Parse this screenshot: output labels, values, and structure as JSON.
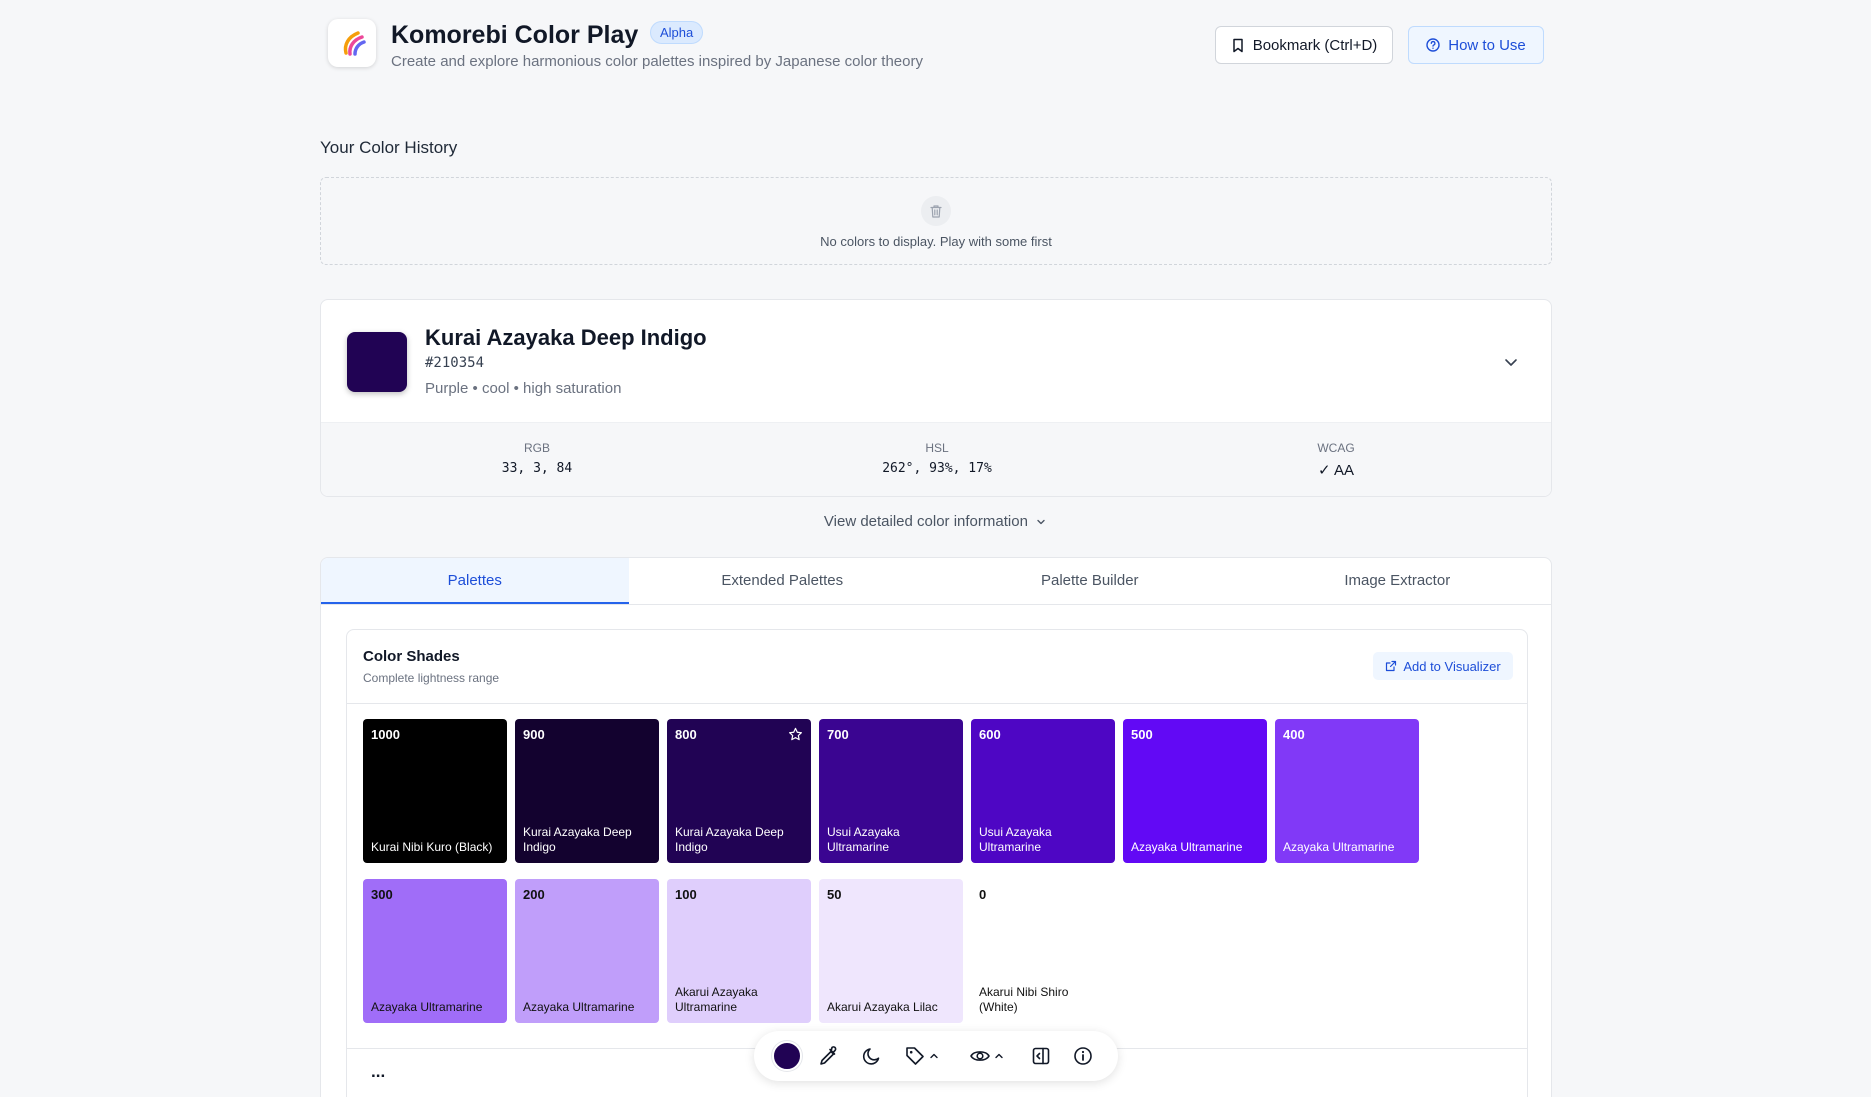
{
  "header": {
    "title": "Komorebi Color Play",
    "badge": "Alpha",
    "subtitle": "Create and explore harmonious color palettes inspired by Japanese color theory",
    "bookmark_label": "Bookmark (Ctrl+D)",
    "howto_label": "How to Use"
  },
  "history": {
    "title": "Your Color History",
    "empty_text": "No colors to display. Play with some first"
  },
  "color": {
    "name": "Kurai Azayaka Deep Indigo",
    "hex": "#210354",
    "description": "Purple • cool • high saturation",
    "swatch_color": "#210354",
    "rgb_label": "RGB",
    "rgb_value": "33, 3, 84",
    "hsl_label": "HSL",
    "hsl_value": "262°, 93%, 17%",
    "wcag_label": "WCAG",
    "wcag_value": "✓ AA"
  },
  "view_detail_label": "View detailed color information",
  "tabs": [
    {
      "label": "Palettes",
      "active": true
    },
    {
      "label": "Extended Palettes",
      "active": false
    },
    {
      "label": "Palette Builder",
      "active": false
    },
    {
      "label": "Image Extractor",
      "active": false
    }
  ],
  "shades": {
    "title": "Color Shades",
    "subtitle": "Complete lightness range",
    "visualizer_label": "Add to Visualizer",
    "more": "...",
    "items": [
      {
        "num": "1000",
        "name": "Kurai Nibi Kuro (Black)",
        "color": "#000000",
        "text_color": "#ffffff",
        "starred": false
      },
      {
        "num": "900",
        "name": "Kurai Azayaka Deep Indigo",
        "color": "#13022f",
        "text_color": "#ffffff",
        "starred": false
      },
      {
        "num": "800",
        "name": "Kurai Azayaka Deep Indigo",
        "color": "#210354",
        "text_color": "#ffffff",
        "starred": true
      },
      {
        "num": "700",
        "name": "Usui Azayaka Ultramarine",
        "color": "#3a0591",
        "text_color": "#ffffff",
        "starred": false
      },
      {
        "num": "600",
        "name": "Usui Azayaka Ultramarine",
        "color": "#4e06c4",
        "text_color": "#ffffff",
        "starred": false
      },
      {
        "num": "500",
        "name": "Azayaka Ultramarine",
        "color": "#6209f5",
        "text_color": "#ffffff",
        "starred": false
      },
      {
        "num": "400",
        "name": "Azayaka Ultramarine",
        "color": "#8139f7",
        "text_color": "#ffffff",
        "starred": false
      },
      {
        "num": "300",
        "name": "Azayaka Ultramarine",
        "color": "#a06df8",
        "text_color": "#111111",
        "starred": false
      },
      {
        "num": "200",
        "name": "Azayaka Ultramarine",
        "color": "#c09efa",
        "text_color": "#111111",
        "starred": false
      },
      {
        "num": "100",
        "name": "Akarui Azayaka Ultramarine",
        "color": "#dfcefc",
        "text_color": "#111111",
        "starred": false
      },
      {
        "num": "50",
        "name": "Akarui Azayaka Lilac",
        "color": "#efe6fd",
        "text_color": "#111111",
        "starred": false
      },
      {
        "num": "0",
        "name": "Akarui Nibi Shiro (White)",
        "color": "#ffffff",
        "text_color": "#111111",
        "starred": false
      }
    ]
  },
  "toolbar": {
    "current_color": "#210354",
    "icons": [
      "eyedropper-icon",
      "moon-icon",
      "tag-icon",
      "eye-icon",
      "panel-icon",
      "info-icon"
    ]
  }
}
